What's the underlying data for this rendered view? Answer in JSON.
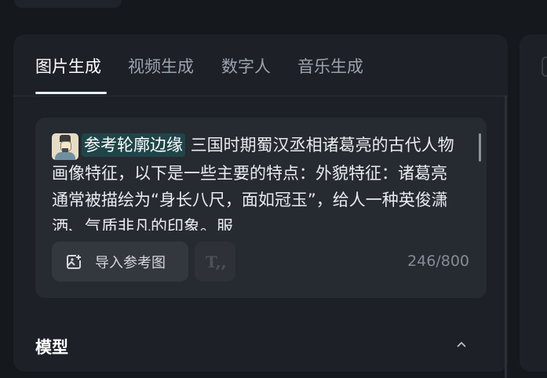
{
  "tabs": [
    {
      "label": "图片生成",
      "active": true
    },
    {
      "label": "视频生成",
      "active": false
    },
    {
      "label": "数字人",
      "active": false
    },
    {
      "label": "音乐生成",
      "active": false
    }
  ],
  "prompt": {
    "reference_chip": "参考轮廓边缘",
    "text": "三国时期蜀汉丞相诸葛亮的古代人物画像特征，以下是一些主要的特点：外貌特征：诸葛亮通常被描绘为“身长八尺，面如冠玉”，给人一种英俊潇洒、气质非凡的印象。服",
    "import_button": "导入参考图",
    "counter": "246/800"
  },
  "section": {
    "title": "模型"
  },
  "colors": {
    "panel": "#1d2026",
    "card": "#262a31",
    "chip": "#1f4549",
    "active_tab": "#ffffff",
    "inactive_tab": "#9aa3ae"
  },
  "icons": {
    "import": "image-add-icon",
    "format": "text-format-icon",
    "collapse": "chevron-up-icon"
  }
}
